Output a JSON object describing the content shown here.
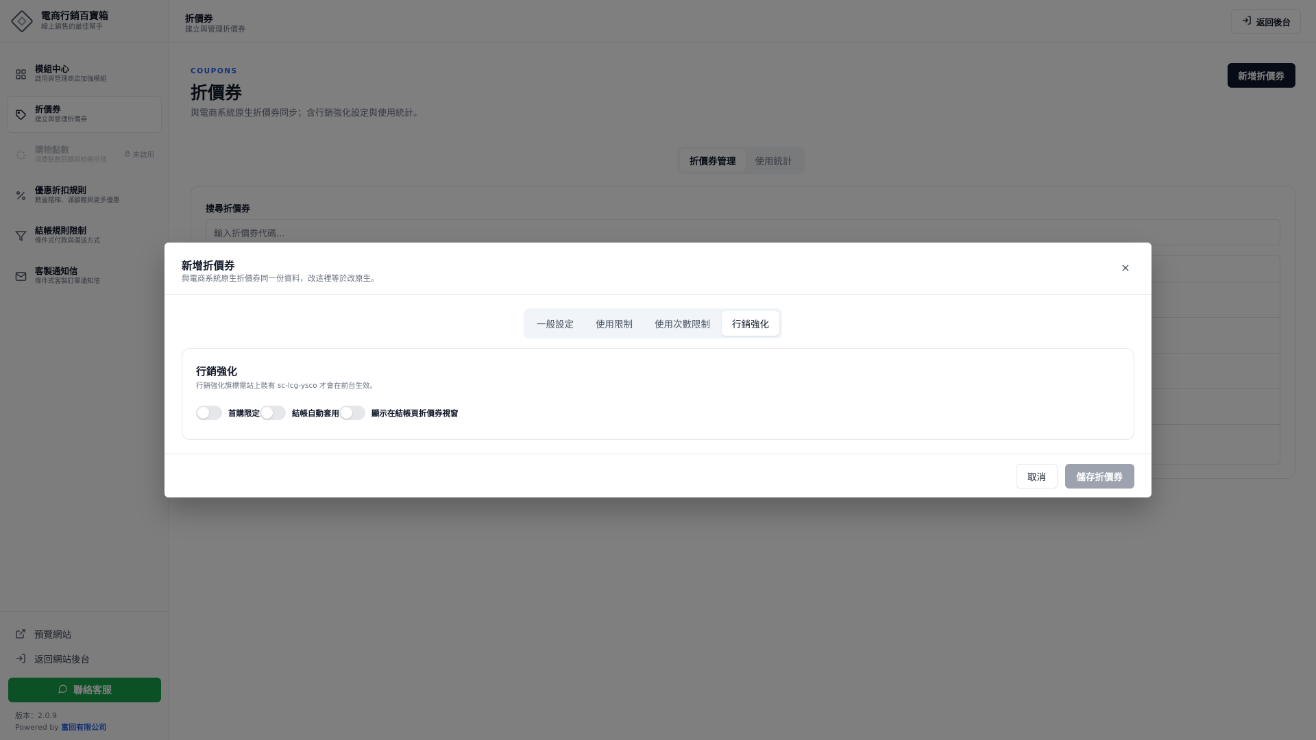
{
  "brand": {
    "title": "電商行銷百寶箱",
    "subtitle": "線上銷售的最佳幫手"
  },
  "sidebar": {
    "items": [
      {
        "title": "模組中心",
        "subtitle": "啟用與管理商店加強模組",
        "icon": "grid-icon"
      },
      {
        "title": "折價券",
        "subtitle": "建立與管理折價券",
        "icon": "tag-icon"
      },
      {
        "title": "購物點數",
        "subtitle": "消費點數回饋與結帳折抵",
        "icon": "loader-icon",
        "badge": "未啟用"
      },
      {
        "title": "優惠折扣規則",
        "subtitle": "數量階梯、滿額贈與更多優惠",
        "icon": "percent-icon"
      },
      {
        "title": "結帳規則限制",
        "subtitle": "條件式付款與運送方式",
        "icon": "filter-icon"
      },
      {
        "title": "客製通知信",
        "subtitle": "條件式客製訂單通知信",
        "icon": "mail-icon"
      }
    ],
    "bottom": {
      "preview_site": "預覽網站",
      "back_site_admin": "返回網站後台",
      "contact": "聯絡客服",
      "version": "版本：2.0.9",
      "powered_by": "Powered by",
      "company": "富回有限公司"
    }
  },
  "topbar": {
    "title": "折價券",
    "subtitle": "建立與管理折價券",
    "back_button": "返回後台"
  },
  "main": {
    "eyebrow": "COUPONS",
    "title": "折價券",
    "description": "與電商系統原生折價券同步；含行銷強化設定與使用統計。",
    "new_button": "新增折價券",
    "tabs": [
      {
        "label": "折價券管理"
      },
      {
        "label": "使用統計"
      }
    ],
    "search": {
      "label": "搜尋折價券",
      "placeholder": "輸入折價券代碼..."
    }
  },
  "modal": {
    "title": "新增折價券",
    "subtitle": "與電商系統原生折價券同一份資料，改這裡等於改原生。",
    "tabs": [
      {
        "label": "一般設定"
      },
      {
        "label": "使用限制"
      },
      {
        "label": "使用次數限制"
      },
      {
        "label": "行銷強化"
      }
    ],
    "active_tab": "行銷強化",
    "section": {
      "title": "行銷強化",
      "note": "行銷強化旗標需站上裝有 sc-lcg-ysco 才會在前台生效。",
      "toggles": [
        {
          "label": "首購限定",
          "on": false
        },
        {
          "label": "結帳自動套用",
          "on": false
        },
        {
          "label": "顯示在結帳頁折價券視窗",
          "on": false
        }
      ]
    },
    "cancel": "取消",
    "save": "儲存折價券"
  },
  "colors": {
    "primary_dark": "#0f172a",
    "contact_green": "#16a34a",
    "accent_blue": "#2563eb",
    "disabled_save": "#9ca3af"
  }
}
